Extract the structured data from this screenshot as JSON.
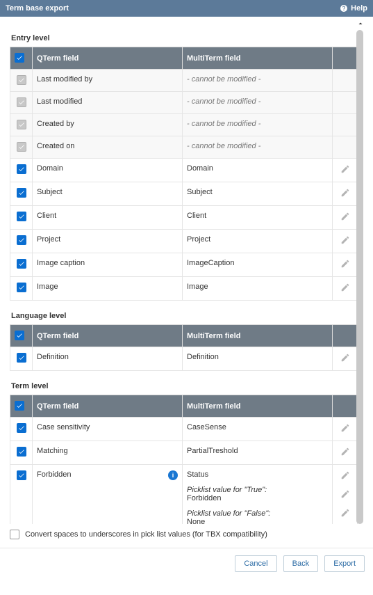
{
  "header": {
    "title": "Term base export",
    "help": "Help"
  },
  "columns": {
    "qterm": "QTerm field",
    "multi": "MultiTerm field"
  },
  "sections": {
    "entry": {
      "title": "Entry level",
      "rows": [
        {
          "q": "Last modified by",
          "m": "- cannot be modified -",
          "locked": true
        },
        {
          "q": "Last modified",
          "m": "- cannot be modified -",
          "locked": true
        },
        {
          "q": "Created by",
          "m": "- cannot be modified -",
          "locked": true
        },
        {
          "q": "Created on",
          "m": "- cannot be modified -",
          "locked": true
        },
        {
          "q": "Domain",
          "m": "Domain"
        },
        {
          "q": "Subject",
          "m": "Subject"
        },
        {
          "q": "Client",
          "m": "Client"
        },
        {
          "q": "Project",
          "m": "Project"
        },
        {
          "q": "Image caption",
          "m": "ImageCaption"
        },
        {
          "q": "Image",
          "m": "Image"
        }
      ]
    },
    "language": {
      "title": "Language level",
      "rows": [
        {
          "q": "Definition",
          "m": "Definition"
        }
      ]
    },
    "term": {
      "title": "Term level",
      "rows": [
        {
          "q": "Case sensitivity",
          "m": "CaseSense"
        },
        {
          "q": "Matching",
          "m": "PartialTreshold"
        },
        {
          "q": "Forbidden",
          "m": "Status",
          "info": true,
          "picklist": {
            "trueLabel": "Picklist value for \"True\":",
            "trueValue": "Forbidden",
            "falseLabel": "Picklist value for \"False\":",
            "falseValue": "None"
          }
        }
      ]
    }
  },
  "convert": {
    "label": "Convert spaces to underscores in pick list values (for TBX compatibility)"
  },
  "buttons": {
    "cancel": "Cancel",
    "back": "Back",
    "export": "Export"
  }
}
